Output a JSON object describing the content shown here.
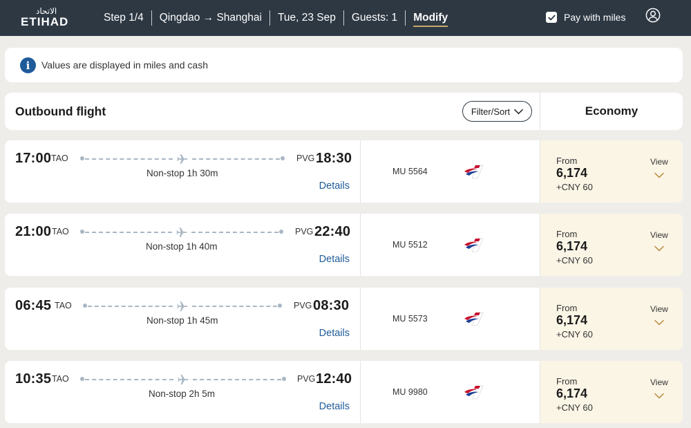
{
  "header": {
    "logo_arabic": "الاتحاد",
    "logo_text": "ETIHAD",
    "step": "Step 1/4",
    "route": "Qingdao → Shanghai",
    "date": "Tue, 23 Sep",
    "guests": "Guests: 1",
    "modify": "Modify",
    "pay_with_miles_label": "Pay with miles",
    "pay_with_miles_checked": true
  },
  "info_banner": {
    "icon": "info-icon",
    "text": "Values are displayed in miles and cash"
  },
  "section": {
    "title": "Outbound flight",
    "filter_sort": "Filter/Sort",
    "cabin": "Economy"
  },
  "flights": [
    {
      "dep_time": "17:00",
      "dep_code": "TAO",
      "arr_time": "18:30",
      "arr_code": "PVG",
      "stops": "Non-stop 1h 30m",
      "details": "Details",
      "flight_no": "MU 5564",
      "fare_from": "From",
      "miles": "6,174",
      "cash": "+CNY 60",
      "view": "View"
    },
    {
      "dep_time": "21:00",
      "dep_code": "TAO",
      "arr_time": "22:40",
      "arr_code": "PVG",
      "stops": "Non-stop 1h 40m",
      "details": "Details",
      "flight_no": "MU 5512",
      "fare_from": "From",
      "miles": "6,174",
      "cash": "+CNY 60",
      "view": "View"
    },
    {
      "dep_time": "06:45",
      "dep_code": "TAO",
      "arr_time": "08:30",
      "arr_code": "PVG",
      "stops": "Non-stop 1h 45m",
      "details": "Details",
      "flight_no": "MU 5573",
      "fare_from": "From",
      "miles": "6,174",
      "cash": "+CNY 60",
      "view": "View"
    },
    {
      "dep_time": "10:35",
      "dep_code": "TAO",
      "arr_time": "12:40",
      "arr_code": "PVG",
      "stops": "Non-stop 2h 5m",
      "details": "Details",
      "flight_no": "MU 9980",
      "fare_from": "From",
      "miles": "6,174",
      "cash": "+CNY 60",
      "view": "View"
    }
  ],
  "colors": {
    "header_bg": "#2d3843",
    "accent_gold": "#c9a86a",
    "link_blue": "#1f5b99",
    "fare_bg": "#fbf5e6",
    "route_gray": "#a9b6c3"
  }
}
